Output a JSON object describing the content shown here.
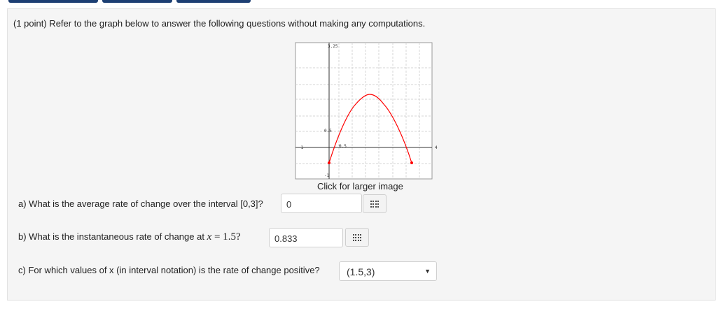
{
  "intro": "(1 point) Refer to the graph below to answer the following questions without making any computations.",
  "graph": {
    "caption": "Click for larger image",
    "tick_labels": {
      "y_top": "3.25",
      "y_mid": "0.5",
      "y_bottom": "-1",
      "x_left": "-1",
      "x_mid": "0.5",
      "x_right": "4"
    },
    "curve_color": "#ff0000",
    "curve_points": [
      {
        "x": 0,
        "y": -0.75
      },
      {
        "x": 3,
        "y": -0.75
      }
    ]
  },
  "questions": {
    "a": {
      "prefix": "a) What is the average rate of change over the interval [0,3]?",
      "answer": "0"
    },
    "b": {
      "prefix": "b) What is the instantaneous rate of change at",
      "math_var": "x",
      "math_rest": " = 1.5?",
      "answer": "0.833"
    },
    "c": {
      "prefix": "c) For which values of x (in interval notation) is the rate of change positive?",
      "selected": "(1.5,3)",
      "arrow": "▼"
    }
  },
  "colors": {
    "tab_color": "#1d3f73",
    "panel_bg": "#f5f5f5"
  }
}
